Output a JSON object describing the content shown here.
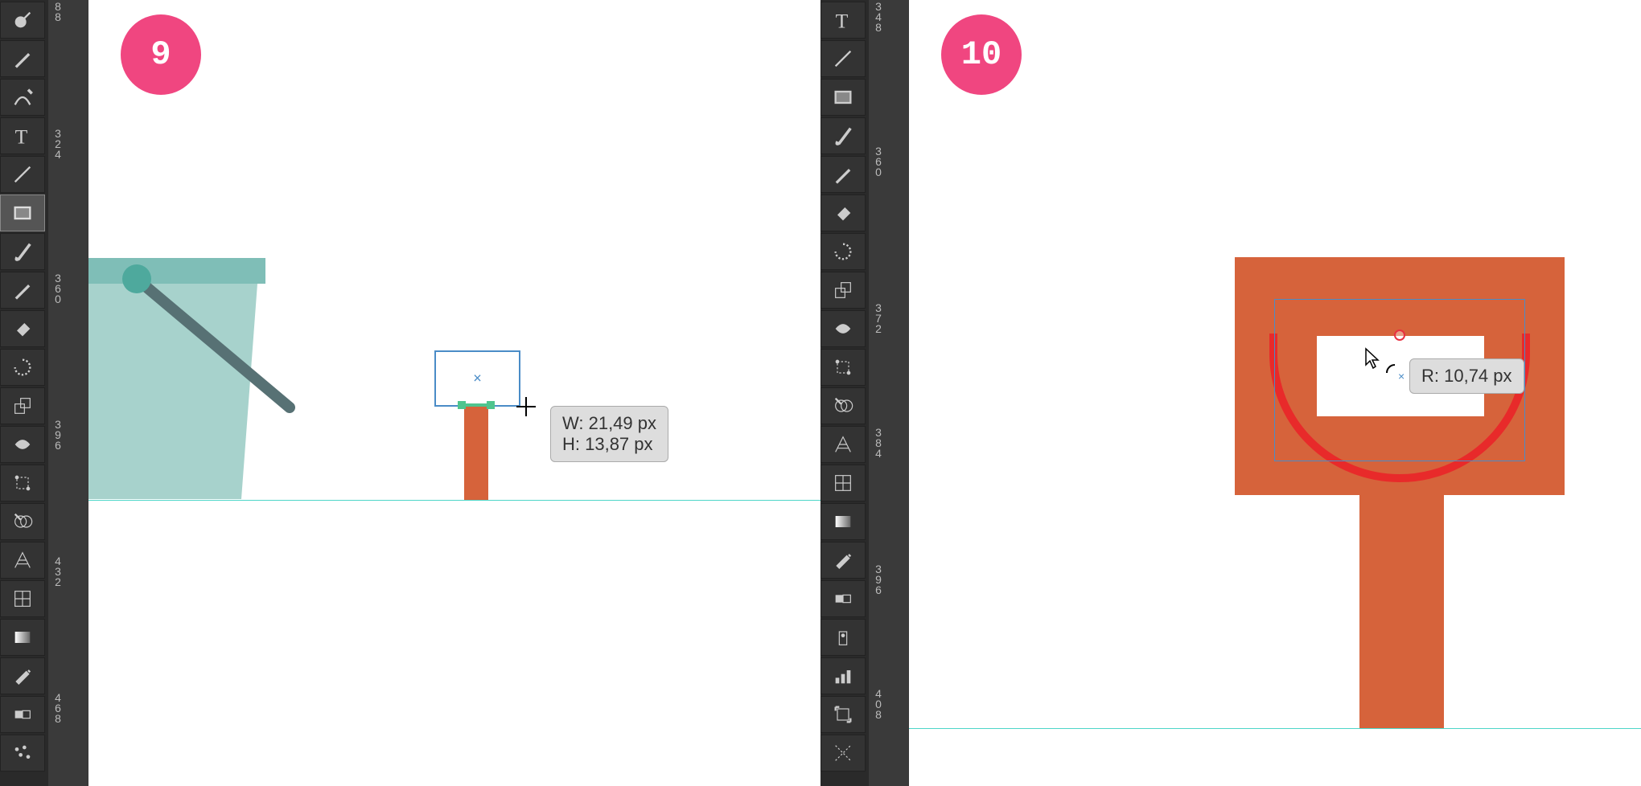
{
  "steps": {
    "left_badge": "9",
    "right_badge": "10"
  },
  "toolbar_left": {
    "tools": [
      {
        "name": "blob-brush-tool"
      },
      {
        "name": "pencil-tool"
      },
      {
        "name": "curvature-tool"
      },
      {
        "name": "type-tool"
      },
      {
        "name": "line-tool"
      },
      {
        "name": "rectangle-tool",
        "selected": true
      },
      {
        "name": "paintbrush-tool"
      },
      {
        "name": "pencil2-tool"
      },
      {
        "name": "eraser-tool"
      },
      {
        "name": "rotate-tool"
      },
      {
        "name": "scale-tool"
      },
      {
        "name": "width-tool"
      },
      {
        "name": "free-transform-tool"
      },
      {
        "name": "shape-builder-tool"
      },
      {
        "name": "perspective-grid-tool"
      },
      {
        "name": "mesh-tool"
      },
      {
        "name": "gradient-tool"
      },
      {
        "name": "eyedropper-tool"
      },
      {
        "name": "blend-tool"
      },
      {
        "name": "symbol-sprayer-tool"
      }
    ]
  },
  "toolbar_right": {
    "tools": [
      {
        "name": "type-tool"
      },
      {
        "name": "line-tool"
      },
      {
        "name": "rectangle-tool"
      },
      {
        "name": "paintbrush-tool"
      },
      {
        "name": "pencil-tool"
      },
      {
        "name": "eraser-tool"
      },
      {
        "name": "rotate-tool"
      },
      {
        "name": "scale-tool"
      },
      {
        "name": "width-tool"
      },
      {
        "name": "free-transform-tool"
      },
      {
        "name": "shape-builder-tool"
      },
      {
        "name": "perspective-grid-tool"
      },
      {
        "name": "mesh-tool"
      },
      {
        "name": "gradient-tool"
      },
      {
        "name": "eyedropper-tool"
      },
      {
        "name": "blend-tool"
      },
      {
        "name": "symbol-sprayer-tool"
      },
      {
        "name": "graph-tool"
      },
      {
        "name": "artboard-tool"
      },
      {
        "name": "slice-tool"
      }
    ]
  },
  "ruler_left": [
    "88",
    "324",
    "360",
    "396",
    "432",
    "468"
  ],
  "ruler_right": [
    "348",
    "360",
    "372",
    "384",
    "396",
    "408"
  ],
  "tooltip_left": {
    "line1": "W: 21,49 px",
    "line2": "H: 13,87 px"
  },
  "tooltip_right": {
    "line1": "R: 10,74 px"
  },
  "colors": {
    "bucket_body": "#a7d2cc",
    "bucket_rim": "#7fb8b0",
    "bucket_handle": "#577174",
    "bucket_knob": "#4ea99d",
    "shovel_orange": "#d6633b",
    "shovel_red_stroke": "#e82a2a",
    "guide": "#4ed6c8",
    "badge": "#f04680"
  }
}
